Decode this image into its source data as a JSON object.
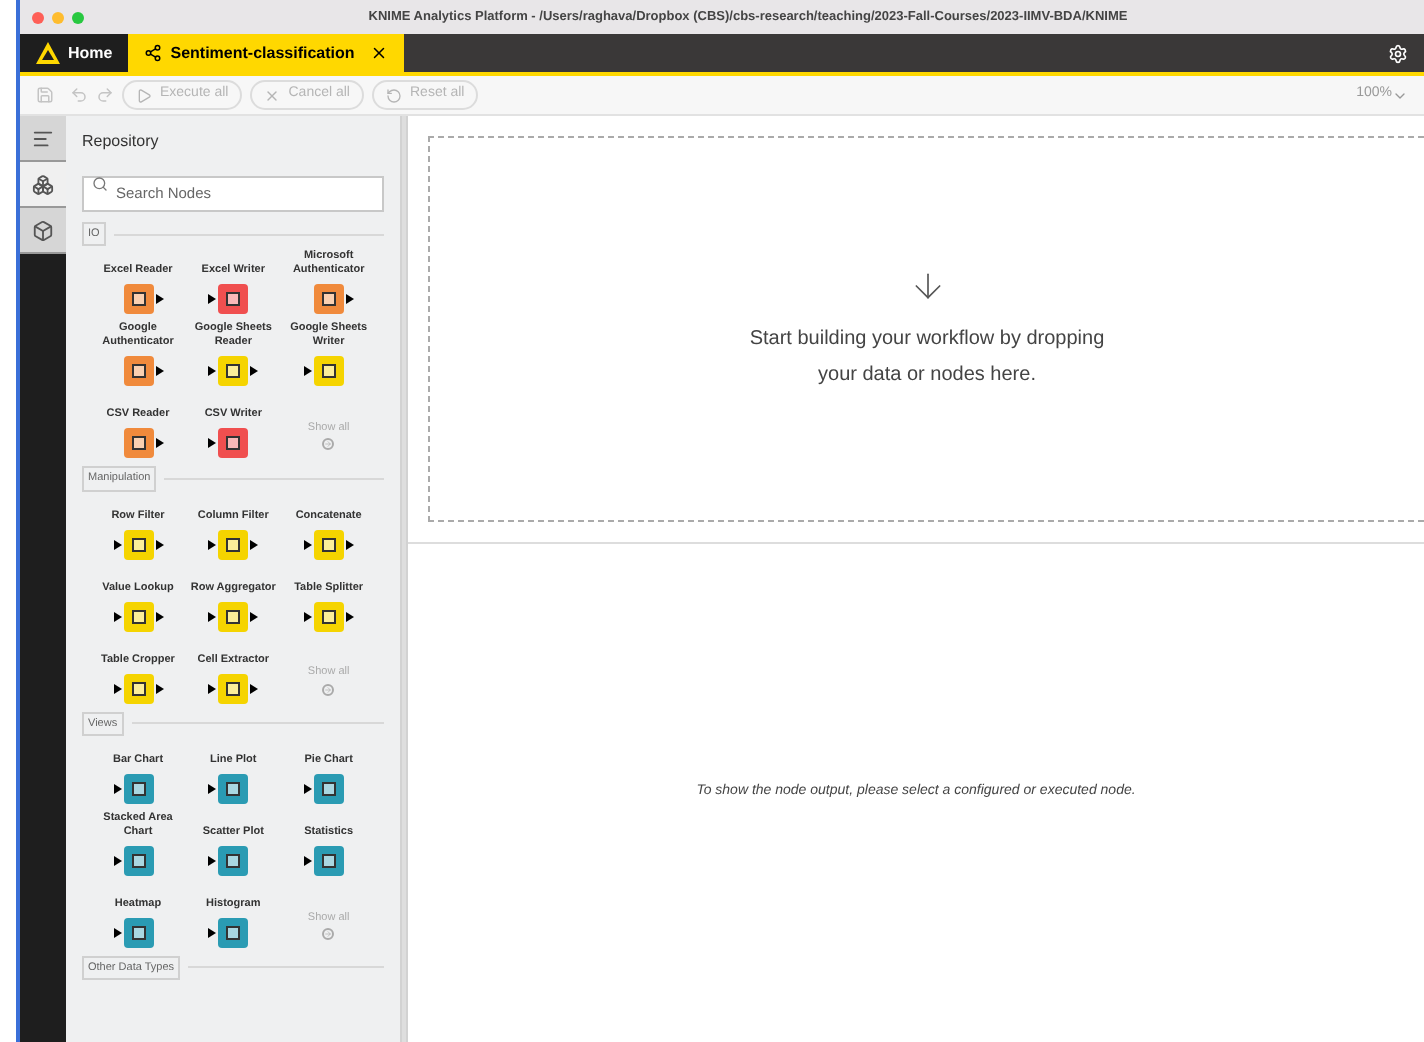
{
  "window": {
    "title": "KNIME Analytics Platform - /Users/raghava/Dropbox (CBS)/cbs-research/teaching/2023-Fall-Courses/2023-IIMV-BDA/KNIME"
  },
  "tabs": [
    {
      "label": "Home",
      "selected": false,
      "kind": "home"
    },
    {
      "label": "Sentiment-classification",
      "selected": true,
      "kind": "workflow"
    }
  ],
  "toolbar": {
    "buttons": [
      {
        "label": "Execute all",
        "kind": "execute"
      },
      {
        "label": "Cancel all",
        "kind": "cancel"
      },
      {
        "label": "Reset all",
        "kind": "reset"
      }
    ],
    "zoom": "100%"
  },
  "rail": [
    {
      "kind": "description",
      "selected": false
    },
    {
      "kind": "nodes",
      "selected": true
    },
    {
      "kind": "space",
      "selected": false
    }
  ],
  "repository": {
    "title": "Repository",
    "search_placeholder": "Search Nodes",
    "categories": [
      {
        "name": "IO",
        "show_all": "Show all",
        "nodes": [
          {
            "name": "Excel Reader",
            "color": "#f08a3c",
            "has_input": false,
            "has_output": true
          },
          {
            "name": "Excel Writer",
            "color": "#f04f4f",
            "has_input": true,
            "has_output": false
          },
          {
            "name": "Microsoft Authenticator",
            "color": "#f08a3c",
            "has_input": false,
            "has_output": true
          },
          {
            "name": "Google Authenticator",
            "color": "#f08a3c",
            "has_input": false,
            "has_output": true
          },
          {
            "name": "Google Sheets Reader",
            "color": "#f5d400",
            "has_input": true,
            "has_output": true
          },
          {
            "name": "Google Sheets Writer",
            "color": "#f5d400",
            "has_input": true,
            "has_output": false
          },
          {
            "name": "CSV Reader",
            "color": "#f08a3c",
            "has_input": false,
            "has_output": true
          },
          {
            "name": "CSV Writer",
            "color": "#f04f4f",
            "has_input": true,
            "has_output": false
          }
        ]
      },
      {
        "name": "Manipulation",
        "show_all": "Show all",
        "nodes": [
          {
            "name": "Row Filter",
            "color": "#f5d400",
            "has_input": true,
            "has_output": true
          },
          {
            "name": "Column Filter",
            "color": "#f5d400",
            "has_input": true,
            "has_output": true
          },
          {
            "name": "Concatenate",
            "color": "#f5d400",
            "has_input": true,
            "has_output": true
          },
          {
            "name": "Value Lookup",
            "color": "#f5d400",
            "has_input": true,
            "has_output": true
          },
          {
            "name": "Row Aggregator",
            "color": "#f5d400",
            "has_input": true,
            "has_output": true
          },
          {
            "name": "Table Splitter",
            "color": "#f5d400",
            "has_input": true,
            "has_output": true
          },
          {
            "name": "Table Cropper",
            "color": "#f5d400",
            "has_input": true,
            "has_output": true
          },
          {
            "name": "Cell Extractor",
            "color": "#f5d400",
            "has_input": true,
            "has_output": true
          }
        ]
      },
      {
        "name": "Views",
        "show_all": "Show all",
        "nodes": [
          {
            "name": "Bar Chart",
            "color": "#2a9bb3",
            "has_input": true,
            "has_output": false
          },
          {
            "name": "Line Plot",
            "color": "#2a9bb3",
            "has_input": true,
            "has_output": false
          },
          {
            "name": "Pie Chart",
            "color": "#2a9bb3",
            "has_input": true,
            "has_output": false
          },
          {
            "name": "Stacked Area Chart",
            "color": "#2a9bb3",
            "has_input": true,
            "has_output": false
          },
          {
            "name": "Scatter Plot",
            "color": "#2a9bb3",
            "has_input": true,
            "has_output": false
          },
          {
            "name": "Statistics",
            "color": "#2a9bb3",
            "has_input": true,
            "has_output": false
          },
          {
            "name": "Heatmap",
            "color": "#2a9bb3",
            "has_input": true,
            "has_output": false
          },
          {
            "name": "Histogram",
            "color": "#2a9bb3",
            "has_input": true,
            "has_output": false
          }
        ]
      },
      {
        "name": "Other Data Types"
      }
    ]
  },
  "canvas": {
    "hint": "Start building your workflow by dropping your data or nodes here."
  },
  "output": {
    "message": "To show the node output, please select a configured or executed node."
  }
}
